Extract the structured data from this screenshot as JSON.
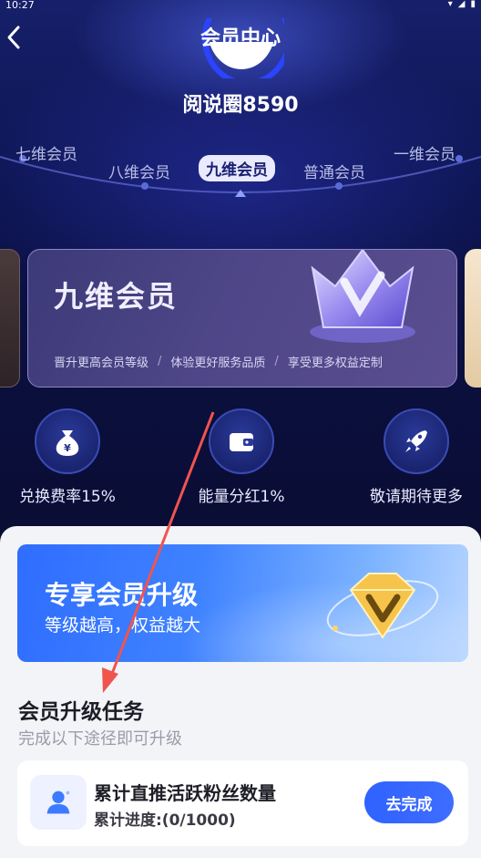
{
  "status_bar": {
    "time": "10:27"
  },
  "header": {
    "title": "会员中心",
    "back_icon": "chevron-left-icon"
  },
  "profile": {
    "username": "阅说圈8590"
  },
  "levels": {
    "items": [
      "七维会员",
      "八维会员",
      "九维会员",
      "普通会员",
      "一维会员"
    ],
    "selected": "九维会员"
  },
  "member_card": {
    "title": "九维会员",
    "benefits": [
      "晋升更高会员等级",
      "体验更好服务品质",
      "享受更多权益定制"
    ]
  },
  "quick_benefits": [
    {
      "icon": "money-bag-icon",
      "label": "兑换费率15%"
    },
    {
      "icon": "wallet-icon",
      "label": "能量分红1%"
    },
    {
      "icon": "rocket-icon",
      "label": "敬请期待更多"
    }
  ],
  "upgrade_banner": {
    "title": "专享会员升级",
    "subtitle": "等级越高，权益越大"
  },
  "tasks": {
    "title": "会员升级任务",
    "subtitle": "完成以下途径即可升级",
    "items": [
      {
        "icon": "user-icon",
        "title": "累计直推活跃粉丝数量",
        "progress": "累计进度:(0/1000)",
        "button": "去完成"
      }
    ]
  },
  "colors": {
    "accent": "#2f62ff",
    "annotation_arrow": "#f0544f"
  }
}
